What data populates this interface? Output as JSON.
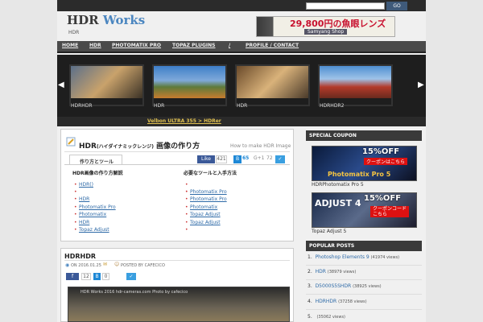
{
  "header": {
    "logo_a": "HDR",
    "logo_b": " Works",
    "tagline": "HDR",
    "search_go": "GO",
    "banner": {
      "text": "29,800円の魚眼レンズ",
      "badge": "Samyang Shop"
    }
  },
  "nav": [
    "HOME",
    "HDR",
    "PHOTOMATIX PRO",
    "TOPAZ PLUGINS",
    "/",
    "PROFILE / CONTACT"
  ],
  "slider": {
    "prev": "◀",
    "next": "▶",
    "captions": [
      "HDRHDR",
      "HDR",
      "HDR",
      "HDRHDR2"
    ]
  },
  "strip_link": "Velbon  ULTRA 355 > HDRer",
  "hdr_box": {
    "title": "HDR",
    "title_small": "(ハイダイナミックレンジ)",
    "title_rest": " 画像の作り方",
    "english": "How to make HDR Image",
    "like": "Like",
    "like_count": "421",
    "b_count": "65",
    "g_label": "G+1",
    "g_count": "72",
    "tab": "作り方とツール",
    "left_heading": "HDR画像の作り方解説",
    "left_items": [
      "HDR()",
      "",
      "HDR",
      "Photomatix Pro",
      "Photomatix",
      "HDR",
      "Topaz Adjust"
    ],
    "right_heading": "必要なツールと入手方法",
    "right_items": [
      "",
      "",
      "Photomatix Pro",
      "Photomatix Pro",
      "Photomatix",
      "Topaz Adjust",
      "Topaz Adjust",
      ""
    ]
  },
  "post": {
    "title": "HDRHDR",
    "date": "ON 2016.01.25",
    "author": "POSTED BY CAFECICO",
    "like_count": "12",
    "c_count": "0",
    "img_text": "HDR Works 2016  hdr-cameras.com  Photo by cafecico"
  },
  "sidebar": {
    "coupon_heading": "SPECIAL COUPON",
    "coupons": [
      {
        "off": "15%OFF",
        "sub": "クーポンはこちら",
        "label": "Photomatix Pro 5",
        "caption": "HDRPhotomatix Pro 5"
      },
      {
        "off": "15%OFF",
        "sub": "クーポンコード\nこちら",
        "label": "ADJUST 4",
        "caption": "Topaz Adjust 5"
      }
    ],
    "popular_heading": "POPULAR POSTS",
    "popular": [
      {
        "n": "1.",
        "t": "Photoshop Elements 9",
        "v": "(41974 views)"
      },
      {
        "n": "2.",
        "t": "HDR",
        "v": "(38979 views)"
      },
      {
        "n": "3.",
        "t": "D5000S5SHDR",
        "v": "(38925 views)"
      },
      {
        "n": "4.",
        "t": "HDRHDR",
        "v": "(37258 views)"
      },
      {
        "n": "5.",
        "t": "",
        "v": "(35062 views)"
      }
    ]
  },
  "colors": {
    "accent": "#4b86c0",
    "link": "#2e6aa7",
    "nav_bg": "#4a4a4a"
  }
}
